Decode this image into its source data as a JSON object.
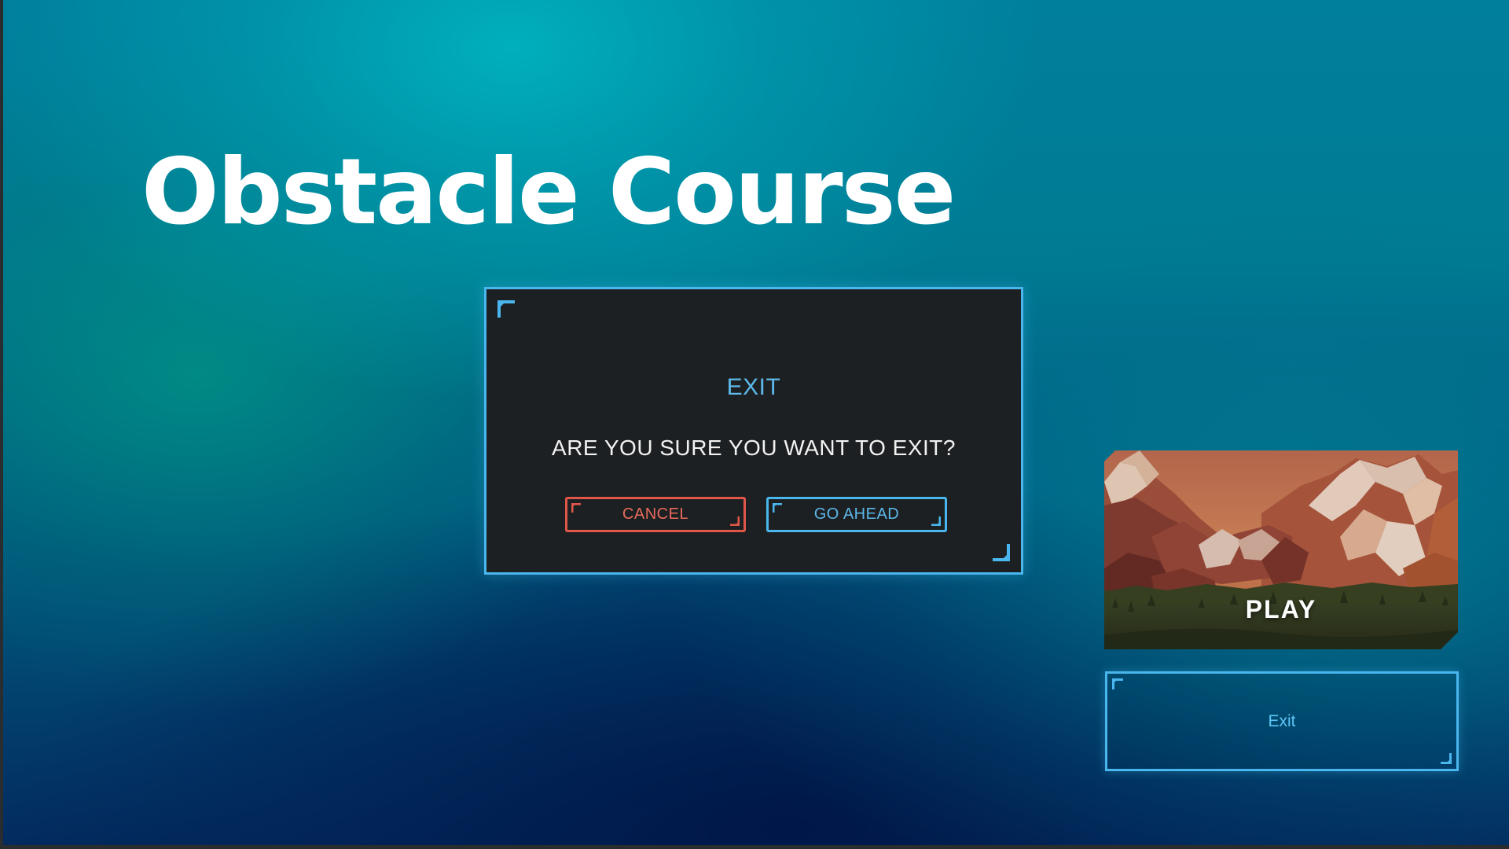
{
  "game": {
    "title": "Obstacle Course"
  },
  "dialog": {
    "title": "EXIT",
    "message": "ARE YOU SURE YOU WANT TO EXIT?",
    "cancel_label": "CANCEL",
    "confirm_label": "GO AHEAD"
  },
  "menu": {
    "play_label": "PLAY",
    "exit_label": "Exit"
  },
  "colors": {
    "accent_blue": "#49b6ee",
    "cancel_red": "#e0574a",
    "dialog_bg": "#1d2022",
    "text_white": "#ffffff"
  },
  "icons": {
    "corner_bracket": "corner-bracket-icon",
    "play_thumbnail": "mountain-landscape-thumbnail"
  }
}
